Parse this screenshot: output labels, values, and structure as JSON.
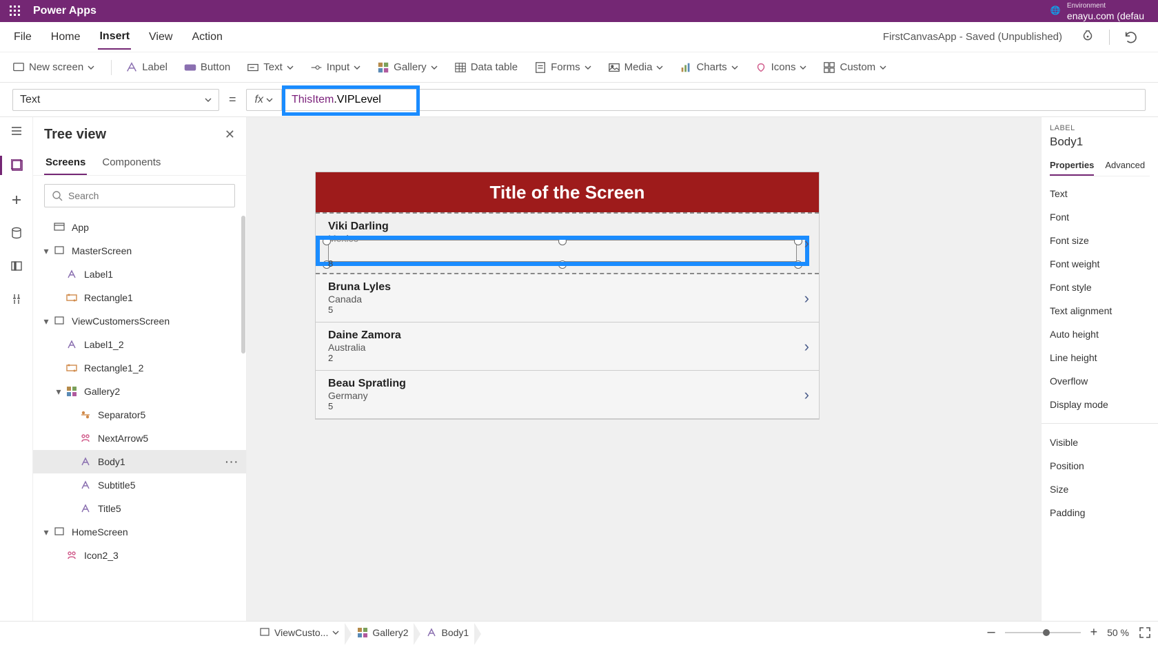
{
  "header": {
    "app_name": "Power Apps",
    "env_label": "Environment",
    "env_value": "enayu.com (defau"
  },
  "menu": {
    "items": [
      "File",
      "Home",
      "Insert",
      "View",
      "Action"
    ],
    "active_index": 2,
    "app_status": "FirstCanvasApp - Saved (Unpublished)"
  },
  "ribbon": [
    {
      "label": "New screen",
      "has_chevron": true
    },
    {
      "label": "Label"
    },
    {
      "label": "Button"
    },
    {
      "label": "Text",
      "has_chevron": true
    },
    {
      "label": "Input",
      "has_chevron": true
    },
    {
      "label": "Gallery",
      "has_chevron": true
    },
    {
      "label": "Data table"
    },
    {
      "label": "Forms",
      "has_chevron": true
    },
    {
      "label": "Media",
      "has_chevron": true
    },
    {
      "label": "Charts",
      "has_chevron": true
    },
    {
      "label": "Icons",
      "has_chevron": true
    },
    {
      "label": "Custom",
      "has_chevron": true
    }
  ],
  "formula": {
    "property": "Text",
    "fx_label": "fx",
    "value_obj": "ThisItem",
    "value_prop": ".VIPLevel"
  },
  "tree": {
    "title": "Tree view",
    "tabs": [
      "Screens",
      "Components"
    ],
    "active_tab": 0,
    "search_placeholder": "Search",
    "nodes": [
      {
        "depth": 0,
        "exp": "",
        "icon": "app",
        "label": "App"
      },
      {
        "depth": 0,
        "exp": "▾",
        "icon": "screen",
        "label": "MasterScreen"
      },
      {
        "depth": 1,
        "exp": "",
        "icon": "label",
        "label": "Label1"
      },
      {
        "depth": 1,
        "exp": "",
        "icon": "rect",
        "label": "Rectangle1"
      },
      {
        "depth": 0,
        "exp": "▾",
        "icon": "screen",
        "label": "ViewCustomersScreen"
      },
      {
        "depth": 1,
        "exp": "",
        "icon": "label",
        "label": "Label1_2"
      },
      {
        "depth": 1,
        "exp": "",
        "icon": "rect",
        "label": "Rectangle1_2"
      },
      {
        "depth": 1,
        "exp": "▾",
        "icon": "gallery",
        "label": "Gallery2"
      },
      {
        "depth": 2,
        "exp": "",
        "icon": "sep",
        "label": "Separator5"
      },
      {
        "depth": 2,
        "exp": "",
        "icon": "arrow",
        "label": "NextArrow5"
      },
      {
        "depth": 2,
        "exp": "",
        "icon": "label",
        "label": "Body1",
        "selected": true,
        "more": true
      },
      {
        "depth": 2,
        "exp": "",
        "icon": "label",
        "label": "Subtitle5"
      },
      {
        "depth": 2,
        "exp": "",
        "icon": "label",
        "label": "Title5"
      },
      {
        "depth": 0,
        "exp": "▾",
        "icon": "screen",
        "label": "HomeScreen"
      },
      {
        "depth": 1,
        "exp": "",
        "icon": "arrow",
        "label": "Icon2_3"
      }
    ]
  },
  "canvas": {
    "title": "Title of the Screen",
    "items": [
      {
        "name": "Viki  Darling",
        "country": "Mexico",
        "vip": "8"
      },
      {
        "name": "Bruna  Lyles",
        "country": "Canada",
        "vip": "5"
      },
      {
        "name": "Daine  Zamora",
        "country": "Australia",
        "vip": "2"
      },
      {
        "name": "Beau  Spratling",
        "country": "Germany",
        "vip": "5"
      }
    ]
  },
  "properties": {
    "label": "LABEL",
    "sel_name": "Body1",
    "tabs": [
      "Properties",
      "Advanced"
    ],
    "active_tab": 0,
    "rows_a": [
      "Text",
      "Font",
      "Font size",
      "Font weight",
      "Font style",
      "Text alignment",
      "Auto height",
      "Line height",
      "Overflow",
      "Display mode"
    ],
    "rows_b": [
      "Visible",
      "Position",
      "Size",
      "Padding"
    ]
  },
  "breadcrumb": {
    "items": [
      {
        "icon": "screen",
        "label": "ViewCusto..."
      },
      {
        "icon": "gallery",
        "label": "Gallery2"
      },
      {
        "icon": "label",
        "label": "Body1"
      }
    ],
    "zoom_minus": "–",
    "zoom_plus": "+",
    "zoom_value": "50  %"
  }
}
